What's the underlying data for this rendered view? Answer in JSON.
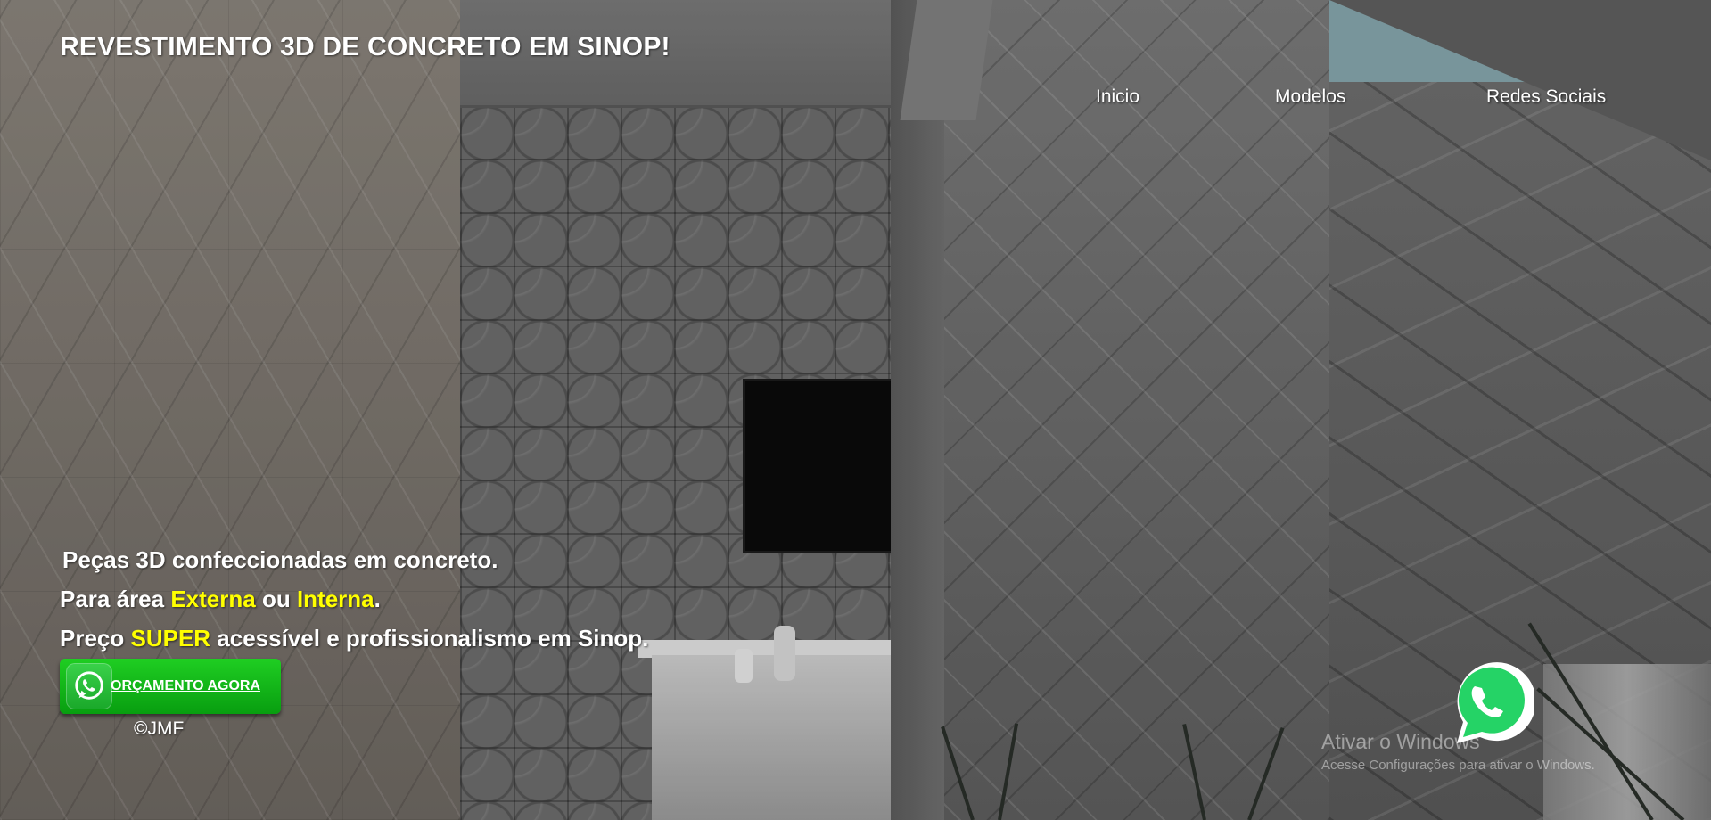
{
  "header": {
    "site_title": "REVESTIMENTO 3D DE CONCRETO EM SINOP!"
  },
  "nav": {
    "items": [
      {
        "label": "Inicio"
      },
      {
        "label": "Modelos"
      },
      {
        "label": "Redes Sociais"
      }
    ]
  },
  "hero": {
    "line1": "Peças 3D confeccionadas em concreto.",
    "line2": {
      "prefix": "Para área ",
      "highlight1": "Externa",
      "middle": " ou ",
      "highlight2": "Interna",
      "suffix": "."
    },
    "line3": {
      "prefix": "Preço ",
      "highlight": "SUPER",
      "suffix": " acessível e profissionalismo em Sinop."
    },
    "cta_label": "ORÇAMENTO AGORA",
    "credit": "©JMF"
  },
  "floating": {
    "icon": "whatsapp-icon"
  },
  "windows_watermark": {
    "title": "Ativar o Windows",
    "subtitle": "Acesse Configurações para ativar o Windows."
  },
  "colors": {
    "highlight": "#ffff00",
    "cta_green": "#13b81b",
    "whatsapp_green": "#25d366"
  }
}
